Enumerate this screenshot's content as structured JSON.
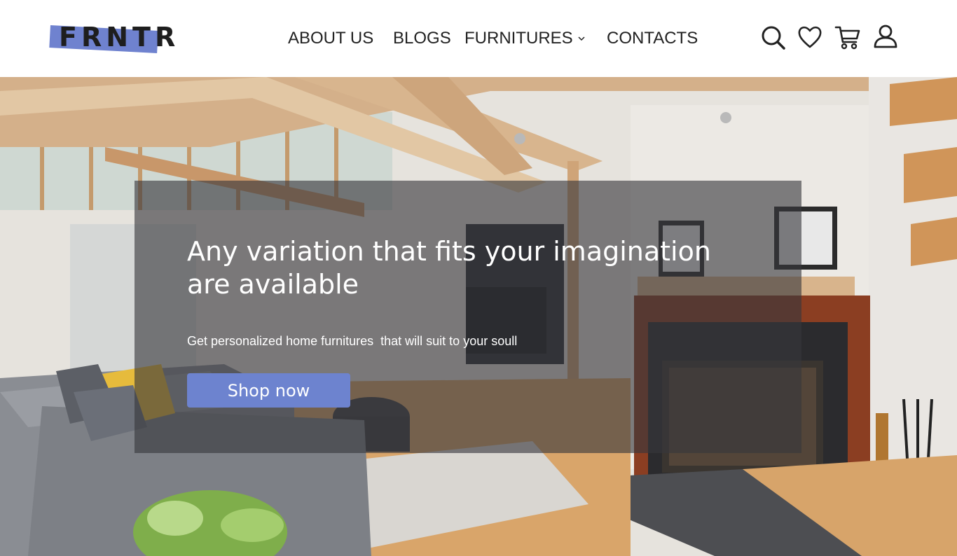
{
  "brand": {
    "name": "FRNTR",
    "accent": "#6f82cf"
  },
  "nav": {
    "about": "ABOUT US",
    "blogs": "BLOGS",
    "furnitures": "FURNITURES",
    "contacts": "CONTACTS"
  },
  "header_icons": [
    "search-icon",
    "heart-icon",
    "cart-icon",
    "user-icon"
  ],
  "hero": {
    "title": "Any variation that fits your imagination are available",
    "subtitle": "Get personalized home furnitures  that will suit to your soull",
    "cta": "Shop now",
    "cta_color": "#6d83cf"
  }
}
